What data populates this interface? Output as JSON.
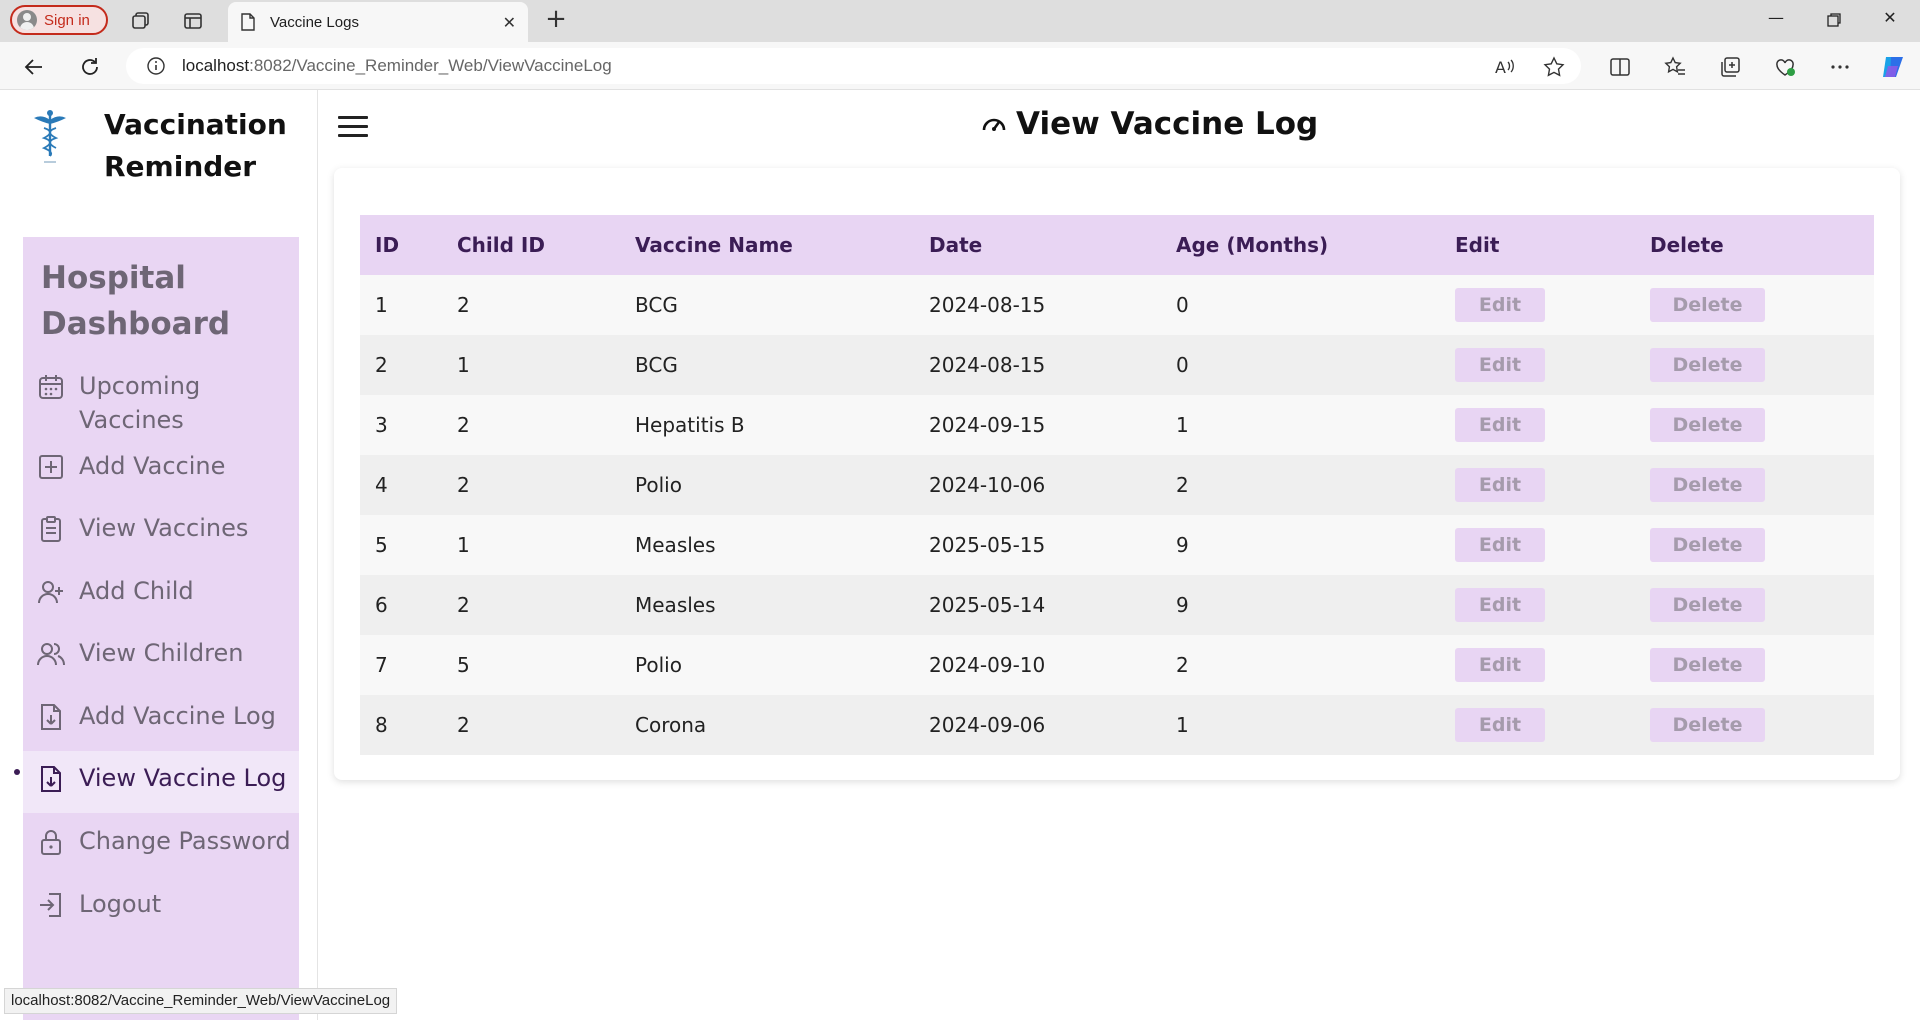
{
  "browser": {
    "sign_in_label": "Sign in",
    "tab_title": "Vaccine Logs",
    "url_host": "localhost",
    "url_path": ":8082/Vaccine_Reminder_Web/ViewVaccineLog",
    "status_url": "localhost:8082/Vaccine_Reminder_Web/ViewVaccineLog"
  },
  "sidebar": {
    "brand": "Vaccination Reminder",
    "menu_title": "Hospital Dashboard",
    "items": [
      {
        "label": "Upcoming Vaccines",
        "icon": "calendar-icon"
      },
      {
        "label": "Add Vaccine",
        "icon": "plus-square-icon"
      },
      {
        "label": "View Vaccines",
        "icon": "clipboard-icon"
      },
      {
        "label": "Add Child",
        "icon": "user-plus-icon"
      },
      {
        "label": "View Children",
        "icon": "users-icon"
      },
      {
        "label": "Add Vaccine Log",
        "icon": "file-plus-icon"
      },
      {
        "label": "View Vaccine Log",
        "icon": "file-plus-icon",
        "active": true
      },
      {
        "label": "Change Password",
        "icon": "lock-icon"
      },
      {
        "label": "Logout",
        "icon": "logout-icon"
      }
    ]
  },
  "main": {
    "title": "View Vaccine Log",
    "columns": [
      "ID",
      "Child ID",
      "Vaccine Name",
      "Date",
      "Age (Months)",
      "Edit",
      "Delete"
    ],
    "rows": [
      {
        "id": "1",
        "child_id": "2",
        "vaccine": "BCG",
        "date": "2024-08-15",
        "age": "0"
      },
      {
        "id": "2",
        "child_id": "1",
        "vaccine": "BCG",
        "date": "2024-08-15",
        "age": "0"
      },
      {
        "id": "3",
        "child_id": "2",
        "vaccine": "Hepatitis B",
        "date": "2024-09-15",
        "age": "1"
      },
      {
        "id": "4",
        "child_id": "2",
        "vaccine": "Polio",
        "date": "2024-10-06",
        "age": "2"
      },
      {
        "id": "5",
        "child_id": "1",
        "vaccine": "Measles",
        "date": "2025-05-15",
        "age": "9"
      },
      {
        "id": "6",
        "child_id": "2",
        "vaccine": "Measles",
        "date": "2025-05-14",
        "age": "9"
      },
      {
        "id": "7",
        "child_id": "5",
        "vaccine": "Polio",
        "date": "2024-09-10",
        "age": "2"
      },
      {
        "id": "8",
        "child_id": "2",
        "vaccine": "Corona",
        "date": "2024-09-06",
        "age": "1"
      }
    ],
    "edit_label": "Edit",
    "delete_label": "Delete"
  },
  "colors": {
    "accent_light": "#e8d5f3",
    "accent_dark": "#3b1d55",
    "menu_text": "#6e6675"
  }
}
